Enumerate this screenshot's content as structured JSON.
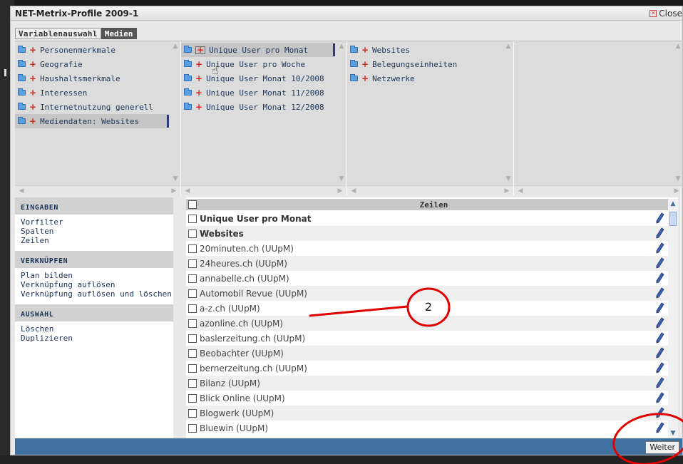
{
  "window": {
    "title": "NET-Metrix-Profile 2009-1",
    "close_label": "Close"
  },
  "tabs": [
    {
      "label": "Variablenauswahl",
      "active": false
    },
    {
      "label": "Medien",
      "active": true
    }
  ],
  "columns": [
    {
      "items": [
        {
          "label": "Personenmerkmale",
          "selected": false
        },
        {
          "label": "Geografie",
          "selected": false
        },
        {
          "label": "Haushaltsmerkmale",
          "selected": false
        },
        {
          "label": "Interessen",
          "selected": false
        },
        {
          "label": "Internetnutzung generell",
          "selected": false
        },
        {
          "label": "Mediendaten: Websites",
          "selected": true
        }
      ]
    },
    {
      "items": [
        {
          "label": "Unique User pro Monat",
          "selected": true
        },
        {
          "label": "Unique User pro Woche",
          "selected": false
        },
        {
          "label": "Unique User Monat 10/2008",
          "selected": false
        },
        {
          "label": "Unique User Monat 11/2008",
          "selected": false
        },
        {
          "label": "Unique User Monat 12/2008",
          "selected": false
        }
      ]
    },
    {
      "items": [
        {
          "label": "Websites",
          "selected": false
        },
        {
          "label": "Belegungseinheiten",
          "selected": false
        },
        {
          "label": "Netzwerke",
          "selected": false
        }
      ]
    },
    {
      "items": []
    }
  ],
  "sidebar": {
    "sections": [
      {
        "heading": "EINGABEN",
        "items": [
          "Vorfilter",
          "Spalten",
          "Zeilen"
        ]
      },
      {
        "heading": "VERKNÜPFEN",
        "items": [
          "Plan bilden",
          "Verknüpfung auflösen",
          "Verknüpfung auflösen und löschen"
        ]
      },
      {
        "heading": "AUSWAHL",
        "items": [
          "Löschen",
          "Duplizieren"
        ]
      }
    ]
  },
  "main": {
    "header": "Zeilen",
    "rows": [
      {
        "label": "Unique User pro Monat",
        "bold": true
      },
      {
        "label": "Websites",
        "bold": true
      },
      {
        "label": "20minuten.ch (UUpM)",
        "bold": false
      },
      {
        "label": "24heures.ch (UUpM)",
        "bold": false
      },
      {
        "label": "annabelle.ch (UUpM)",
        "bold": false
      },
      {
        "label": "Automobil Revue (UUpM)",
        "bold": false
      },
      {
        "label": "a-z.ch (UUpM)",
        "bold": false
      },
      {
        "label": "azonline.ch (UUpM)",
        "bold": false
      },
      {
        "label": "baslerzeitung.ch (UUpM)",
        "bold": false
      },
      {
        "label": "Beobachter (UUpM)",
        "bold": false
      },
      {
        "label": "bernerzeitung.ch (UUpM)",
        "bold": false
      },
      {
        "label": "Bilanz (UUpM)",
        "bold": false
      },
      {
        "label": "Blick Online (UUpM)",
        "bold": false
      },
      {
        "label": "Blogwerk (UUpM)",
        "bold": false
      },
      {
        "label": "Bluewin (UUpM)",
        "bold": false
      }
    ]
  },
  "footer": {
    "next_label": "Weiter"
  },
  "annotation": {
    "number": "2",
    "color": "#e00000"
  }
}
